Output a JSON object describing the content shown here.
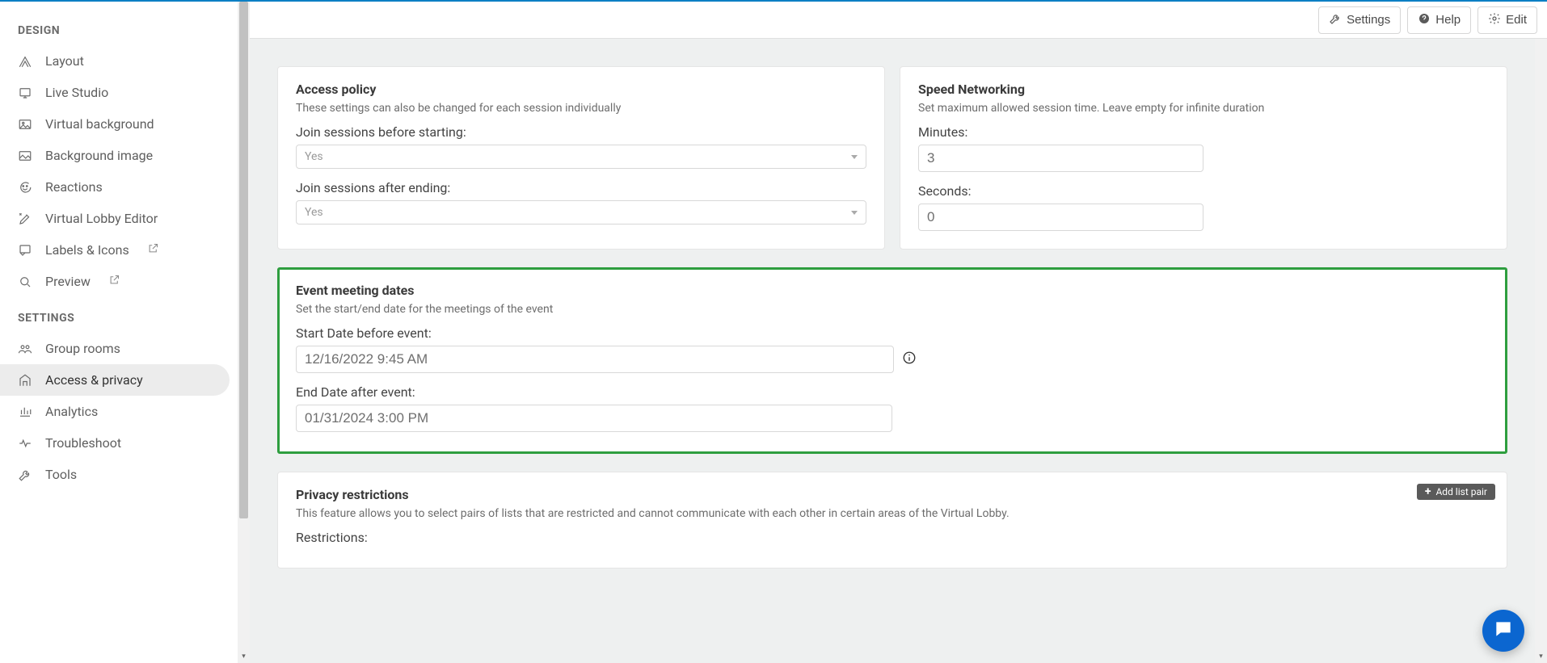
{
  "sidebar": {
    "groups": [
      {
        "label": "DESIGN",
        "items": [
          {
            "id": "layout",
            "label": "Layout"
          },
          {
            "id": "live-studio",
            "label": "Live Studio"
          },
          {
            "id": "virtual-background",
            "label": "Virtual background"
          },
          {
            "id": "background-image",
            "label": "Background image"
          },
          {
            "id": "reactions",
            "label": "Reactions"
          },
          {
            "id": "virtual-lobby-editor",
            "label": "Virtual Lobby Editor"
          },
          {
            "id": "labels-icons",
            "label": "Labels & Icons",
            "ext": true
          },
          {
            "id": "preview",
            "label": "Preview",
            "ext": true
          }
        ]
      },
      {
        "label": "SETTINGS",
        "items": [
          {
            "id": "group-rooms",
            "label": "Group rooms"
          },
          {
            "id": "access-privacy",
            "label": "Access & privacy",
            "active": true
          },
          {
            "id": "analytics",
            "label": "Analytics"
          },
          {
            "id": "troubleshoot",
            "label": "Troubleshoot"
          },
          {
            "id": "tools",
            "label": "Tools"
          }
        ]
      }
    ]
  },
  "topbar": {
    "settings": "Settings",
    "help": "Help",
    "edit": "Edit"
  },
  "access_policy": {
    "title": "Access policy",
    "sub": "These settings can also be changed for each session individually",
    "join_before_label": "Join sessions before starting:",
    "join_before_value": "Yes",
    "join_after_label": "Join sessions after ending:",
    "join_after_value": "Yes"
  },
  "speed_networking": {
    "title": "Speed Networking",
    "sub": "Set maximum allowed session time. Leave empty for infinite duration",
    "minutes_label": "Minutes:",
    "minutes_value": "3",
    "seconds_label": "Seconds:",
    "seconds_value": "0"
  },
  "event_dates": {
    "title": "Event meeting dates",
    "sub": "Set the start/end date for the meetings of the event",
    "start_label": "Start Date before event:",
    "start_value": "12/16/2022 9:45 AM",
    "end_label": "End Date after event:",
    "end_value": "01/31/2024 3:00 PM"
  },
  "privacy": {
    "title": "Privacy restrictions",
    "sub": "This feature allows you to select pairs of lists that are restricted and cannot communicate with each other in certain areas of the Virtual Lobby.",
    "restrictions_label": "Restrictions:",
    "add_pair_label": "Add list pair"
  }
}
